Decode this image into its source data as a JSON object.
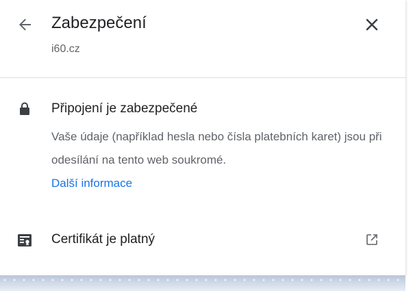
{
  "header": {
    "title": "Zabezpečení",
    "site": "i60.cz"
  },
  "connection": {
    "title": "Připojení je zabezpečené",
    "description": "Vaše údaje (například hesla nebo čísla platebních karet) jsou při odesílání na tento web soukromé.",
    "link": "Další informace"
  },
  "certificate": {
    "label": "Certifikát je platný"
  },
  "icons": {
    "back": "arrow-back-icon",
    "close": "close-icon",
    "lock": "lock-icon",
    "certificate": "certificate-icon",
    "external": "open-in-new-icon"
  },
  "colors": {
    "text_primary": "#202124",
    "text_secondary": "#5f6368",
    "link": "#1a73e8",
    "divider": "#dadce0"
  }
}
